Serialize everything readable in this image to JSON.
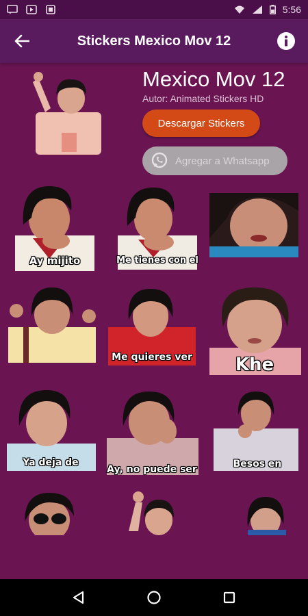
{
  "status_bar": {
    "time": "5:56",
    "icons": [
      "message-icon",
      "play-icon",
      "app-icon",
      "wifi-icon",
      "signal-icon",
      "battery-icon"
    ]
  },
  "app_bar": {
    "title": "Stickers Mexico Mov 12",
    "back_icon": "arrow-left-icon",
    "info_icon": "info-icon"
  },
  "pack": {
    "name": "Mexico Mov 12",
    "author": "Autor: Animated Stickers HD",
    "download_label": "Descargar Stickers",
    "whatsapp_label": "Agregar a Whatsapp"
  },
  "stickers": [
    {
      "caption": "Ay mijito"
    },
    {
      "caption": "Me tienes con el"
    },
    {
      "caption": ""
    },
    {
      "caption": ""
    },
    {
      "caption": "Me quieres ver"
    },
    {
      "caption": "Khe"
    },
    {
      "caption": "Ya deja de"
    },
    {
      "caption": "Ay, no puede ser"
    },
    {
      "caption": "Besos en"
    },
    {
      "caption": ""
    },
    {
      "caption": ""
    },
    {
      "caption": ""
    }
  ],
  "colors": {
    "background": "#6a1552",
    "app_bar": "#5a1a5e",
    "download_button": "#d34a17",
    "whatsapp_button": "#a9a4a7"
  }
}
